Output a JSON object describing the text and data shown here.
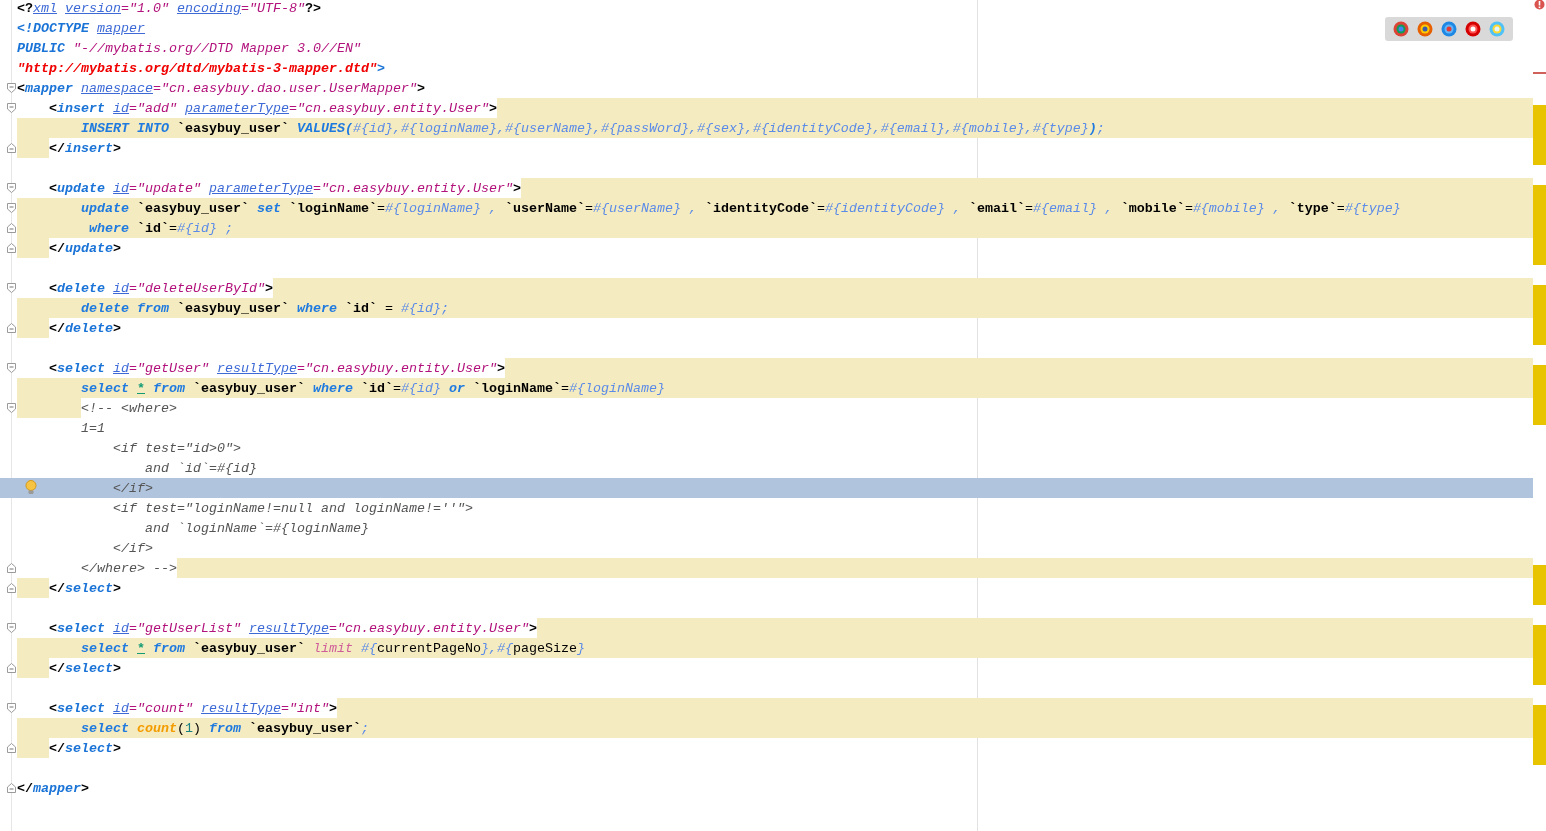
{
  "editor": {
    "lines": [
      {
        "current": false,
        "fold_start": false,
        "fold_end": false,
        "indent_highlighted": false,
        "text_highlighted": false,
        "tail_highlighted": false,
        "tokens": [
          {
            "text": "<?",
            "kind": "punct"
          },
          {
            "text": "xml",
            "kind": "attr"
          },
          {
            "text": " version",
            "kind": "attr"
          },
          {
            "text": "=",
            "kind": "eq"
          },
          {
            "text": "\"1.0\"",
            "kind": "val"
          },
          {
            "text": " encoding",
            "kind": "attr"
          },
          {
            "text": "=",
            "kind": "eq"
          },
          {
            "text": "\"UTF-8\"",
            "kind": "val"
          },
          {
            "text": "?>",
            "kind": "punct"
          }
        ]
      },
      {
        "current": false,
        "fold_start": false,
        "fold_end": false,
        "indent_highlighted": false,
        "text_highlighted": false,
        "tail_highlighted": false,
        "tokens": [
          {
            "text": "<!DOCTYPE",
            "kind": "tag"
          },
          {
            "text": " mapper",
            "kind": "attr"
          }
        ]
      },
      {
        "current": false,
        "fold_start": false,
        "fold_end": false,
        "indent_highlighted": false,
        "text_highlighted": false,
        "tail_highlighted": false,
        "tokens": [
          {
            "text": "PUBLIC",
            "kind": "tag"
          },
          {
            "text": " \"-//mybatis.org//DTD Mapper 3.0//EN\"",
            "kind": "val"
          }
        ]
      },
      {
        "current": false,
        "fold_start": false,
        "fold_end": false,
        "indent_highlighted": false,
        "text_highlighted": false,
        "tail_highlighted": false,
        "tokens": [
          {
            "text": "\"http://mybatis.org/dtd/mybatis-3-mapper.dtd\"",
            "kind": "url"
          },
          {
            "text": ">",
            "kind": "tag"
          }
        ]
      },
      {
        "current": false,
        "fold_start": true,
        "fold_end": false,
        "indent_highlighted": false,
        "text_highlighted": false,
        "tail_highlighted": false,
        "tokens": [
          {
            "text": "<",
            "kind": "punct"
          },
          {
            "text": "mapper",
            "kind": "tag"
          },
          {
            "text": " namespace",
            "kind": "attr"
          },
          {
            "text": "=",
            "kind": "eq"
          },
          {
            "text": "\"cn.easybuy.dao.user.UserMapper\"",
            "kind": "val"
          },
          {
            "text": ">",
            "kind": "punct"
          }
        ]
      },
      {
        "current": false,
        "fold_start": true,
        "fold_end": false,
        "indent_highlighted": false,
        "text_highlighted": false,
        "tail_highlighted": true,
        "tokens": [
          {
            "text": "    <",
            "kind": "punct"
          },
          {
            "text": "insert",
            "kind": "tag"
          },
          {
            "text": " id",
            "kind": "attr"
          },
          {
            "text": "=",
            "kind": "eq"
          },
          {
            "text": "\"add\"",
            "kind": "val"
          },
          {
            "text": " parameterType",
            "kind": "attr"
          },
          {
            "text": "=",
            "kind": "eq"
          },
          {
            "text": "\"cn.easybuy.entity.User\"",
            "kind": "val"
          },
          {
            "text": ">",
            "kind": "punct"
          }
        ]
      },
      {
        "current": false,
        "fold_start": false,
        "fold_end": false,
        "indent_highlighted": true,
        "text_highlighted": true,
        "tail_highlighted": true,
        "tokens": [
          {
            "text": "        INSERT INTO",
            "kind": "kw"
          },
          {
            "text": " `easybuy_user`",
            "kind": "ident"
          },
          {
            "text": " VALUES(",
            "kind": "kw"
          },
          {
            "text": "#{id},#{loginName},#{userName},#{passWord},#{sex},#{identityCode},#{email},#{mobile},#{type}",
            "kind": "param"
          },
          {
            "text": ")",
            "kind": "kw"
          },
          {
            "text": ";",
            "kind": "param"
          }
        ]
      },
      {
        "current": false,
        "fold_start": false,
        "fold_end": true,
        "indent_highlighted": true,
        "text_highlighted": false,
        "tail_highlighted": false,
        "tokens": [
          {
            "text": "    </",
            "kind": "punct"
          },
          {
            "text": "insert",
            "kind": "tag"
          },
          {
            "text": ">",
            "kind": "punct"
          }
        ]
      },
      {
        "current": false,
        "fold_start": false,
        "fold_end": false,
        "indent_highlighted": false,
        "text_highlighted": false,
        "tail_highlighted": false
      },
      {
        "current": false,
        "fold_start": true,
        "fold_end": false,
        "indent_highlighted": false,
        "text_highlighted": false,
        "tail_highlighted": true,
        "tokens": [
          {
            "text": "    <",
            "kind": "punct"
          },
          {
            "text": "update",
            "kind": "tag"
          },
          {
            "text": " id",
            "kind": "attr"
          },
          {
            "text": "=",
            "kind": "eq"
          },
          {
            "text": "\"update\"",
            "kind": "val"
          },
          {
            "text": " parameterType",
            "kind": "attr"
          },
          {
            "text": "=",
            "kind": "eq"
          },
          {
            "text": "\"cn.easybuy.entity.User\"",
            "kind": "val"
          },
          {
            "text": ">",
            "kind": "punct"
          }
        ]
      },
      {
        "current": false,
        "fold_start": true,
        "fold_end": false,
        "indent_highlighted": true,
        "text_highlighted": true,
        "tail_highlighted": true,
        "tokens": [
          {
            "text": "        update",
            "kind": "kw"
          },
          {
            "text": " `easybuy_user`",
            "kind": "ident"
          },
          {
            "text": " set",
            "kind": "kw"
          },
          {
            "text": " `loginName`",
            "kind": "ident"
          },
          {
            "text": "=",
            "kind": "plain"
          },
          {
            "text": "#{loginName} ,",
            "kind": "param"
          },
          {
            "text": " `userName`",
            "kind": "ident"
          },
          {
            "text": "=",
            "kind": "plain"
          },
          {
            "text": "#{userName} ,",
            "kind": "param"
          },
          {
            "text": " `identityCode`",
            "kind": "ident"
          },
          {
            "text": "=",
            "kind": "plain"
          },
          {
            "text": "#{identityCode} ,",
            "kind": "param"
          },
          {
            "text": " `email`",
            "kind": "ident"
          },
          {
            "text": "=",
            "kind": "plain"
          },
          {
            "text": "#{email} ,",
            "kind": "param"
          },
          {
            "text": " `mobile`",
            "kind": "ident"
          },
          {
            "text": "=",
            "kind": "plain"
          },
          {
            "text": "#{mobile} ,",
            "kind": "param"
          },
          {
            "text": " `type`",
            "kind": "ident"
          },
          {
            "text": "=",
            "kind": "plain"
          },
          {
            "text": "#{type}",
            "kind": "param"
          }
        ]
      },
      {
        "current": false,
        "fold_start": false,
        "fold_end": true,
        "indent_highlighted": true,
        "text_highlighted": true,
        "tail_highlighted": true,
        "tokens": [
          {
            "text": "         where",
            "kind": "kw"
          },
          {
            "text": " `id`",
            "kind": "ident"
          },
          {
            "text": "=",
            "kind": "plain"
          },
          {
            "text": "#{id} ;",
            "kind": "param"
          }
        ]
      },
      {
        "current": false,
        "fold_start": false,
        "fold_end": true,
        "indent_highlighted": true,
        "text_highlighted": false,
        "tail_highlighted": false,
        "tokens": [
          {
            "text": "    </",
            "kind": "punct"
          },
          {
            "text": "update",
            "kind": "tag"
          },
          {
            "text": ">",
            "kind": "punct"
          }
        ]
      },
      {
        "current": false,
        "fold_start": false,
        "fold_end": false,
        "indent_highlighted": false,
        "text_highlighted": false,
        "tail_highlighted": false
      },
      {
        "current": false,
        "fold_start": true,
        "fold_end": false,
        "indent_highlighted": false,
        "text_highlighted": false,
        "tail_highlighted": true,
        "tokens": [
          {
            "text": "    <",
            "kind": "punct"
          },
          {
            "text": "delete",
            "kind": "tag"
          },
          {
            "text": " id",
            "kind": "attr"
          },
          {
            "text": "=",
            "kind": "eq"
          },
          {
            "text": "\"deleteUserById\"",
            "kind": "val"
          },
          {
            "text": ">",
            "kind": "punct"
          }
        ]
      },
      {
        "current": false,
        "fold_start": false,
        "fold_end": false,
        "indent_highlighted": true,
        "text_highlighted": true,
        "tail_highlighted": true,
        "tokens": [
          {
            "text": "        delete from",
            "kind": "kw"
          },
          {
            "text": " `easybuy_user`",
            "kind": "ident"
          },
          {
            "text": " where",
            "kind": "kw"
          },
          {
            "text": " `id`",
            "kind": "ident"
          },
          {
            "text": " =",
            "kind": "plain"
          },
          {
            "text": " #{id};",
            "kind": "param"
          }
        ]
      },
      {
        "current": false,
        "fold_start": false,
        "fold_end": true,
        "indent_highlighted": true,
        "text_highlighted": false,
        "tail_highlighted": false,
        "tokens": [
          {
            "text": "    </",
            "kind": "punct"
          },
          {
            "text": "delete",
            "kind": "tag"
          },
          {
            "text": ">",
            "kind": "punct"
          }
        ]
      },
      {
        "current": false,
        "fold_start": false,
        "fold_end": false,
        "indent_highlighted": false,
        "text_highlighted": false,
        "tail_highlighted": false
      },
      {
        "current": false,
        "fold_start": true,
        "fold_end": false,
        "indent_highlighted": false,
        "text_highlighted": false,
        "tail_highlighted": true,
        "tokens": [
          {
            "text": "    <",
            "kind": "punct"
          },
          {
            "text": "select",
            "kind": "tag"
          },
          {
            "text": " id",
            "kind": "attr"
          },
          {
            "text": "=",
            "kind": "eq"
          },
          {
            "text": "\"getUser\"",
            "kind": "val"
          },
          {
            "text": " resultType",
            "kind": "attr"
          },
          {
            "text": "=",
            "kind": "eq"
          },
          {
            "text": "\"cn.easybuy.entity.User\"",
            "kind": "val"
          },
          {
            "text": ">",
            "kind": "punct"
          }
        ]
      },
      {
        "current": false,
        "fold_start": false,
        "fold_end": false,
        "indent_highlighted": true,
        "text_highlighted": true,
        "tail_highlighted": true,
        "tokens": [
          {
            "text": "        select",
            "kind": "kw"
          },
          {
            "text": " *",
            "kind": "star"
          },
          {
            "text": " from",
            "kind": "kw"
          },
          {
            "text": " `easybuy_user`",
            "kind": "ident"
          },
          {
            "text": " where",
            "kind": "kw"
          },
          {
            "text": " `id`",
            "kind": "ident"
          },
          {
            "text": "=",
            "kind": "plain"
          },
          {
            "text": "#{id}",
            "kind": "param"
          },
          {
            "text": " or",
            "kind": "kw"
          },
          {
            "text": " `loginName`",
            "kind": "ident"
          },
          {
            "text": "=",
            "kind": "plain"
          },
          {
            "text": "#{loginName}",
            "kind": "param"
          }
        ]
      },
      {
        "current": false,
        "fold_start": true,
        "fold_end": false,
        "indent_highlighted": true,
        "text_highlighted": false,
        "tail_highlighted": false,
        "tokens": [
          {
            "text": "        <!-- <where>",
            "kind": "comment"
          }
        ]
      },
      {
        "current": false,
        "fold_start": false,
        "fold_end": false,
        "indent_highlighted": false,
        "text_highlighted": false,
        "tail_highlighted": false,
        "tokens": [
          {
            "text": "        1=1",
            "kind": "comment"
          }
        ]
      },
      {
        "current": false,
        "fold_start": false,
        "fold_end": false,
        "indent_highlighted": false,
        "text_highlighted": false,
        "tail_highlighted": false,
        "tokens": [
          {
            "text": "            <if test=\"id>0\">",
            "kind": "comment"
          }
        ]
      },
      {
        "current": false,
        "fold_start": false,
        "fold_end": false,
        "indent_highlighted": false,
        "text_highlighted": false,
        "tail_highlighted": false,
        "tokens": [
          {
            "text": "                and `id`=#{id}",
            "kind": "comment"
          }
        ]
      },
      {
        "current": true,
        "fold_start": false,
        "fold_end": false,
        "indent_highlighted": false,
        "text_highlighted": false,
        "tail_highlighted": false,
        "tokens": [
          {
            "text": "            </if>",
            "kind": "comment"
          }
        ]
      },
      {
        "current": false,
        "fold_start": false,
        "fold_end": false,
        "indent_highlighted": false,
        "text_highlighted": false,
        "tail_highlighted": false,
        "tokens": [
          {
            "text": "            <if test=\"loginName!=null and loginName!=''\">",
            "kind": "comment"
          }
        ]
      },
      {
        "current": false,
        "fold_start": false,
        "fold_end": false,
        "indent_highlighted": false,
        "text_highlighted": false,
        "tail_highlighted": false,
        "tokens": [
          {
            "text": "                and `loginName`=#{loginName}",
            "kind": "comment"
          }
        ]
      },
      {
        "current": false,
        "fold_start": false,
        "fold_end": false,
        "indent_highlighted": false,
        "text_highlighted": false,
        "tail_highlighted": false,
        "tokens": [
          {
            "text": "            </if>",
            "kind": "comment"
          }
        ]
      },
      {
        "current": false,
        "fold_start": false,
        "fold_end": true,
        "indent_highlighted": false,
        "text_highlighted": false,
        "tail_highlighted": true,
        "tokens": [
          {
            "text": "        </where> -->",
            "kind": "comment"
          }
        ]
      },
      {
        "current": false,
        "fold_start": false,
        "fold_end": true,
        "indent_highlighted": true,
        "text_highlighted": false,
        "tail_highlighted": false,
        "tokens": [
          {
            "text": "    </",
            "kind": "punct"
          },
          {
            "text": "select",
            "kind": "tag"
          },
          {
            "text": ">",
            "kind": "punct"
          }
        ]
      },
      {
        "current": false,
        "fold_start": false,
        "fold_end": false,
        "indent_highlighted": false,
        "text_highlighted": false,
        "tail_highlighted": false
      },
      {
        "current": false,
        "fold_start": true,
        "fold_end": false,
        "indent_highlighted": false,
        "text_highlighted": false,
        "tail_highlighted": true,
        "tokens": [
          {
            "text": "    <",
            "kind": "punct"
          },
          {
            "text": "select",
            "kind": "tag"
          },
          {
            "text": " id",
            "kind": "attr"
          },
          {
            "text": "=",
            "kind": "eq"
          },
          {
            "text": "\"getUserList\"",
            "kind": "val"
          },
          {
            "text": " resultType",
            "kind": "attr"
          },
          {
            "text": "=",
            "kind": "eq"
          },
          {
            "text": "\"cn.easybuy.entity.User\"",
            "kind": "val"
          },
          {
            "text": ">",
            "kind": "punct"
          }
        ]
      },
      {
        "current": false,
        "fold_start": false,
        "fold_end": false,
        "indent_highlighted": true,
        "text_highlighted": true,
        "tail_highlighted": true,
        "tokens": [
          {
            "text": "        select",
            "kind": "kw"
          },
          {
            "text": " *",
            "kind": "star"
          },
          {
            "text": " from",
            "kind": "kw"
          },
          {
            "text": " `easybuy_user`",
            "kind": "ident"
          },
          {
            "text": " limit",
            "kind": "limit"
          },
          {
            "text": " #{",
            "kind": "param"
          },
          {
            "text": "currentPageNo",
            "kind": "plain"
          },
          {
            "text": "},#{",
            "kind": "param"
          },
          {
            "text": "pageSize",
            "kind": "plain"
          },
          {
            "text": "}",
            "kind": "param"
          }
        ]
      },
      {
        "current": false,
        "fold_start": false,
        "fold_end": true,
        "indent_highlighted": true,
        "text_highlighted": false,
        "tail_highlighted": false,
        "tokens": [
          {
            "text": "    </",
            "kind": "punct"
          },
          {
            "text": "select",
            "kind": "tag"
          },
          {
            "text": ">",
            "kind": "punct"
          }
        ]
      },
      {
        "current": false,
        "fold_start": false,
        "fold_end": false,
        "indent_highlighted": false,
        "text_highlighted": false,
        "tail_highlighted": false
      },
      {
        "current": false,
        "fold_start": true,
        "fold_end": false,
        "indent_highlighted": false,
        "text_highlighted": false,
        "tail_highlighted": true,
        "tokens": [
          {
            "text": "    <",
            "kind": "punct"
          },
          {
            "text": "select",
            "kind": "tag"
          },
          {
            "text": " id",
            "kind": "attr"
          },
          {
            "text": "=",
            "kind": "eq"
          },
          {
            "text": "\"count\"",
            "kind": "val"
          },
          {
            "text": " resultType",
            "kind": "attr"
          },
          {
            "text": "=",
            "kind": "eq"
          },
          {
            "text": "\"int\"",
            "kind": "val"
          },
          {
            "text": ">",
            "kind": "punct"
          }
        ]
      },
      {
        "current": false,
        "fold_start": false,
        "fold_end": false,
        "indent_highlighted": true,
        "text_highlighted": true,
        "tail_highlighted": true,
        "tokens": [
          {
            "text": "        select",
            "kind": "kw"
          },
          {
            "text": " count",
            "kind": "fn"
          },
          {
            "text": "(",
            "kind": "plain"
          },
          {
            "text": "1",
            "kind": "num"
          },
          {
            "text": ")",
            "kind": "plain"
          },
          {
            "text": " from",
            "kind": "kw"
          },
          {
            "text": " `easybuy_user`",
            "kind": "ident"
          },
          {
            "text": ";",
            "kind": "param"
          }
        ]
      },
      {
        "current": false,
        "fold_start": false,
        "fold_end": true,
        "indent_highlighted": true,
        "text_highlighted": false,
        "tail_highlighted": false,
        "tokens": [
          {
            "text": "    </",
            "kind": "punct"
          },
          {
            "text": "select",
            "kind": "tag"
          },
          {
            "text": ">",
            "kind": "punct"
          }
        ]
      },
      {
        "current": false,
        "fold_start": false,
        "fold_end": false,
        "indent_highlighted": false,
        "text_highlighted": false,
        "tail_highlighted": false
      },
      {
        "current": false,
        "fold_start": false,
        "fold_end": true,
        "indent_highlighted": false,
        "text_highlighted": false,
        "tail_highlighted": false,
        "tokens": [
          {
            "text": "</",
            "kind": "punct"
          },
          {
            "text": "mapper",
            "kind": "tag"
          },
          {
            "text": ">",
            "kind": "punct"
          }
        ]
      }
    ]
  }
}
